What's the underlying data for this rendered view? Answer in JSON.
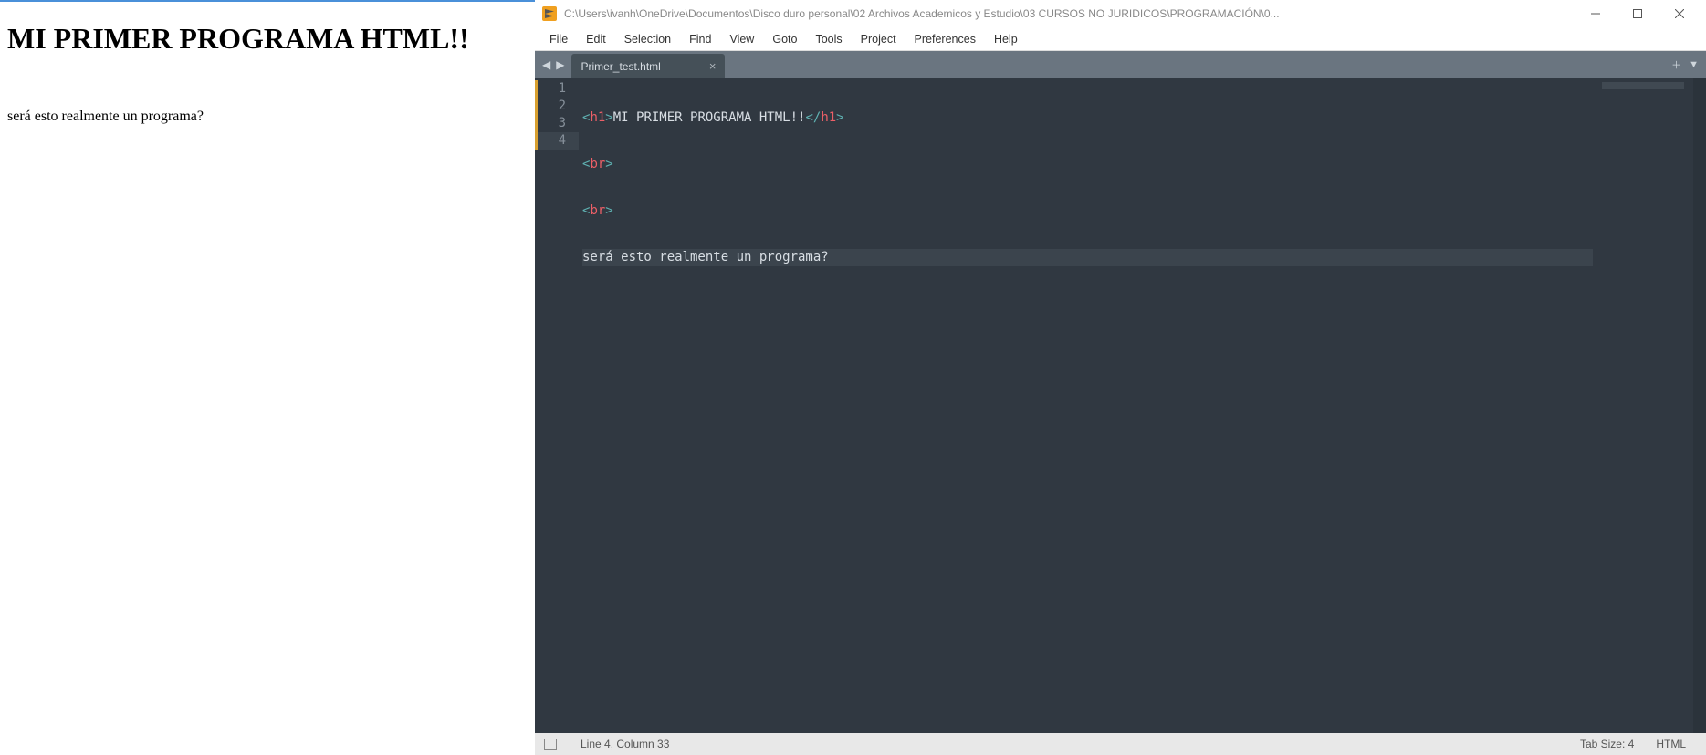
{
  "browser": {
    "heading": "MI PRIMER PROGRAMA HTML!!",
    "paragraph": "será esto realmente un programa?"
  },
  "sublime": {
    "title_path": "C:\\Users\\ivanh\\OneDrive\\Documentos\\Disco duro personal\\02 Archivos Academicos y Estudio\\03 CURSOS NO JURIDICOS\\PROGRAMACIÓN\\0...",
    "menu": [
      "File",
      "Edit",
      "Selection",
      "Find",
      "View",
      "Goto",
      "Tools",
      "Project",
      "Preferences",
      "Help"
    ],
    "tab_name": "Primer_test.html",
    "lines": {
      "l1_open": "<",
      "l1_tag": "h1",
      "l1_gt": ">",
      "l1_text": "MI PRIMER PROGRAMA HTML!!",
      "l1_close_open": "</",
      "l1_close_tag": "h1",
      "l1_close_gt": ">",
      "l2": "<",
      "l2_tag": "br",
      "l2_gt": ">",
      "l3": "<",
      "l3_tag": "br",
      "l3_gt": ">",
      "l4": "será esto realmente un programa?"
    },
    "line_numbers": [
      "1",
      "2",
      "3",
      "4"
    ],
    "status": {
      "cursor": "Line 4, Column 33",
      "tabsize": "Tab Size: 4",
      "syntax": "HTML"
    }
  }
}
